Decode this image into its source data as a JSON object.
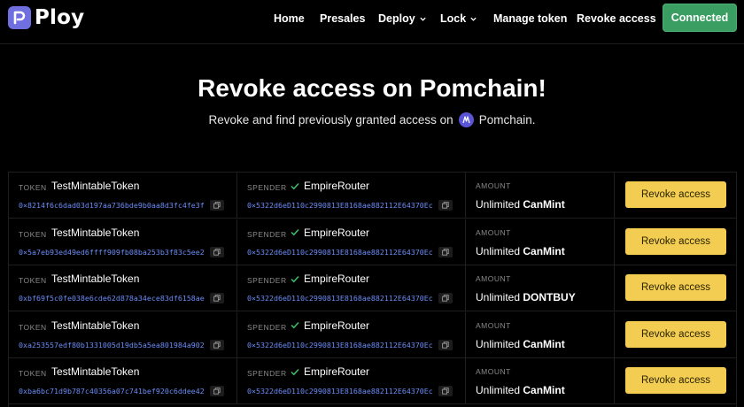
{
  "brand": {
    "name": "Ploy"
  },
  "nav": {
    "home": "Home",
    "presales": "Presales",
    "deploy": "Deploy",
    "lock": "Lock",
    "manage_token": "Manage token",
    "revoke_access": "Revoke access",
    "connected": "Connected"
  },
  "hero": {
    "title": "Revoke access on Pomchain!",
    "subtitle_prefix": "Revoke and find previously granted access on",
    "chain_name": "Pomchain."
  },
  "labels": {
    "token": "TOKEN",
    "spender": "SPENDER",
    "amount": "AMOUNT"
  },
  "rows": [
    {
      "token": "TestMintableToken",
      "token_addr": "0×8214f6c6dad03d197aa736bde9b0aa8d3fc4fe3f",
      "spender": "EmpireRouter",
      "spender_addr": "0×5322d6eD110c2990813E8168ae882112E64370Ec",
      "amount_prefix": "Unlimited",
      "amount_symbol": "CanMint",
      "action": "Revoke access"
    },
    {
      "token": "TestMintableToken",
      "token_addr": "0×5a7eb93ed49ed6ffff909fb08ba253b3f83c5ee2",
      "spender": "EmpireRouter",
      "spender_addr": "0×5322d6eD110c2990813E8168ae882112E64370Ec",
      "amount_prefix": "Unlimited",
      "amount_symbol": "CanMint",
      "action": "Revoke access"
    },
    {
      "token": "TestMintableToken",
      "token_addr": "0xbf69f5c0fe038e6cde62d878a34ece83df6158ae",
      "spender": "EmpireRouter",
      "spender_addr": "0×5322d6eD110c2990813E8168ae882112E64370Ec",
      "amount_prefix": "Unlimited",
      "amount_symbol": "DONTBUY",
      "action": "Revoke access"
    },
    {
      "token": "TestMintableToken",
      "token_addr": "0xa253557edf80b1331005d19db5a5ea801984a902",
      "spender": "EmpireRouter",
      "spender_addr": "0×5322d6eD110c2990813E8168ae882112E64370Ec",
      "amount_prefix": "Unlimited",
      "amount_symbol": "CanMint",
      "action": "Revoke access"
    },
    {
      "token": "TestMintableToken",
      "token_addr": "0xba6bc71d9b787c40356a07c741bef920c6ddee42",
      "spender": "EmpireRouter",
      "spender_addr": "0×5322d6eD110c2990813E8168ae882112E64370Ec",
      "amount_prefix": "Unlimited",
      "amount_symbol": "CanMint",
      "action": "Revoke access"
    }
  ],
  "colors": {
    "background": "#000000",
    "connected_button": "#3a9d62",
    "revoke_button": "#f3cd51",
    "address_link": "#6c8cf5",
    "brand_mark": "#6f6fe0"
  },
  "icons": [
    "ploy-logo-icon",
    "chevron-down-icon",
    "pomchain-icon",
    "check-icon",
    "copy-icon"
  ]
}
